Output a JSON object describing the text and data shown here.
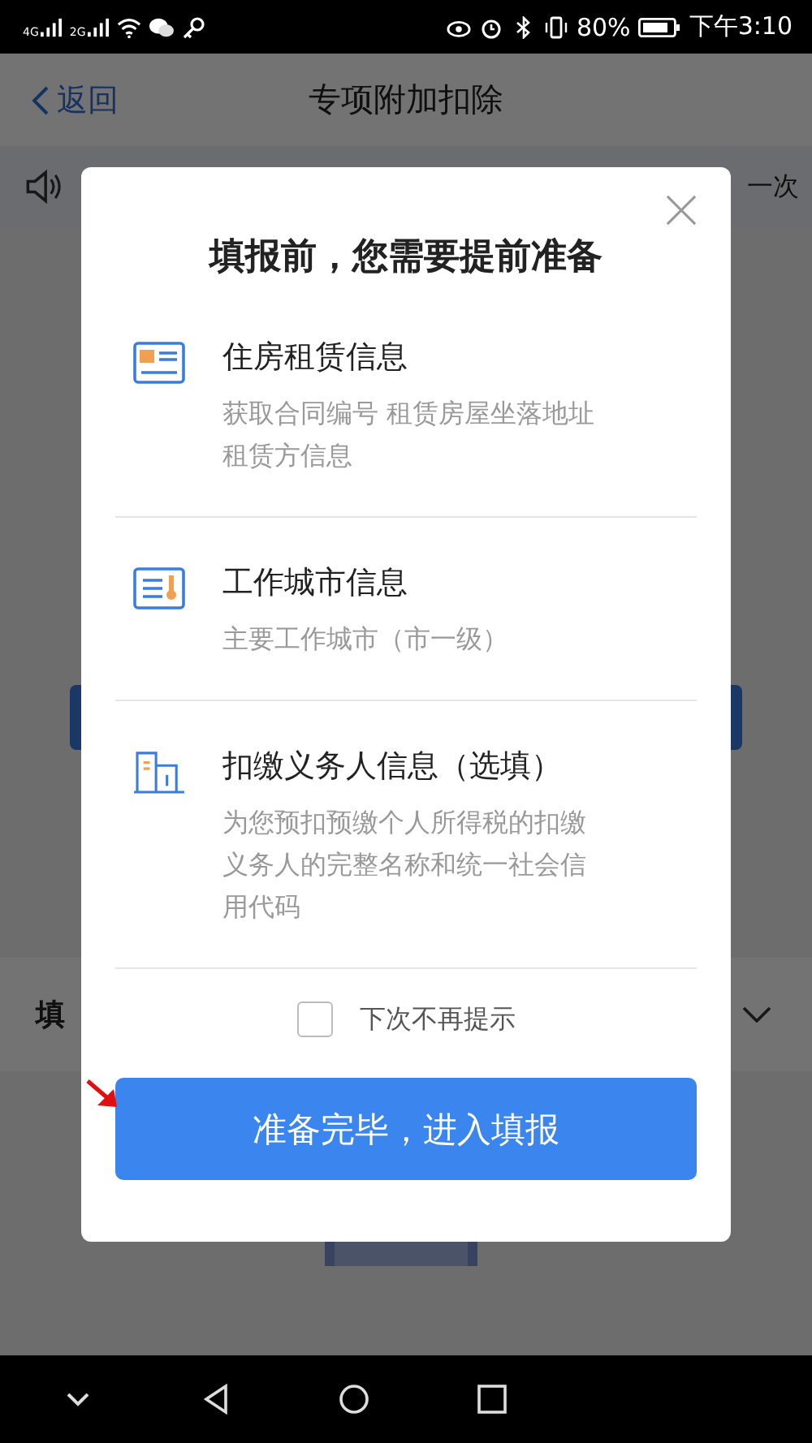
{
  "status_bar": {
    "network_1": "4G",
    "network_2": "2G",
    "battery": "80%",
    "time": "下午3:10"
  },
  "nav_bar": {
    "back": "返回",
    "title": "专项附加扣除"
  },
  "notice": {
    "text": "一次"
  },
  "background": {
    "section_title": "填"
  },
  "dialog": {
    "title": "填报前，您需要提前准备",
    "items": [
      {
        "kind": "rent",
        "title": "住房租赁信息",
        "desc_lines": [
          "获取合同编号 租赁房屋坐落地址",
          "租赁方信息"
        ]
      },
      {
        "kind": "city",
        "title": "工作城市信息",
        "desc_lines": [
          "主要工作城市（市一级）"
        ]
      },
      {
        "kind": "employer",
        "title": "扣缴义务人信息（选填）",
        "desc_lines": [
          "为您预扣预缴个人所得税的扣缴",
          "义务人的完整名称和统一社会信",
          "用代码"
        ]
      }
    ],
    "dont_show_again": {
      "label": "下次不再提示",
      "checked": false
    },
    "confirm_button": "准备完毕，进入填报"
  }
}
